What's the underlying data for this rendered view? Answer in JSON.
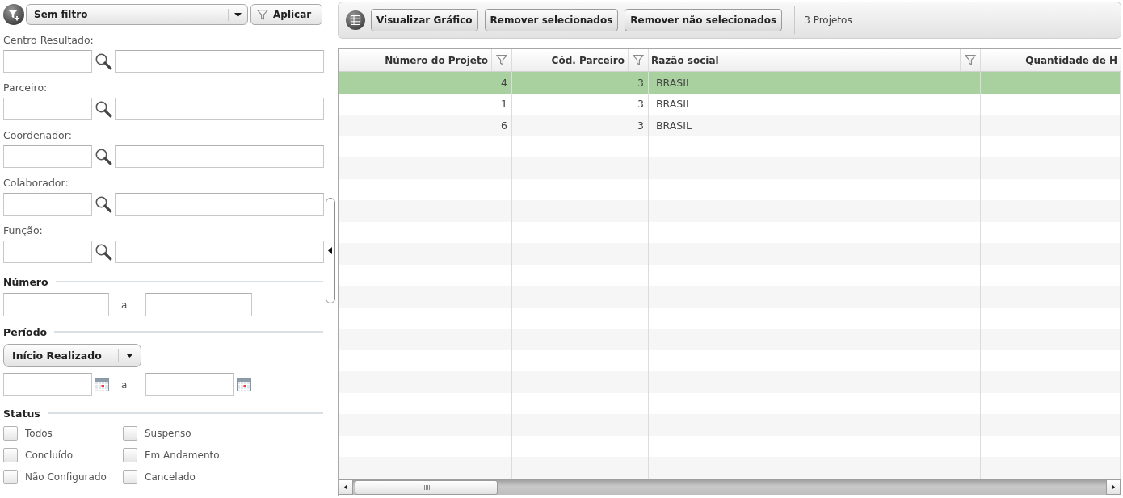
{
  "filter_bar": {
    "preset": "Sem filtro",
    "apply_button": "Aplicar"
  },
  "lookups": [
    {
      "label": "Centro Resultado:"
    },
    {
      "label": "Parceiro:"
    },
    {
      "label": "Coordenador:"
    },
    {
      "label": "Colaborador:"
    },
    {
      "label": "Função:"
    }
  ],
  "number_range": {
    "title": "Número",
    "separator": "a"
  },
  "period": {
    "title": "Período",
    "date_type": "Início Realizado",
    "separator": "a"
  },
  "status": {
    "title": "Status",
    "options": [
      {
        "label": "Todos",
        "checked": false
      },
      {
        "label": "Suspenso",
        "checked": false
      },
      {
        "label": "Concluído",
        "checked": false
      },
      {
        "label": "Em Andamento",
        "checked": false
      },
      {
        "label": "Não Configurado",
        "checked": false
      },
      {
        "label": "Cancelado",
        "checked": false
      }
    ]
  },
  "toolbar": {
    "buttons": [
      "Visualizar Gráfico",
      "Remover selecionados",
      "Remover não selecionados"
    ],
    "count": "3 Projetos"
  },
  "grid": {
    "columns": [
      {
        "label": "Número do Projeto",
        "kind": "number",
        "filter": true
      },
      {
        "label": "Cód. Parceiro",
        "kind": "number",
        "filter": true
      },
      {
        "label": "Razão social",
        "kind": "text",
        "filter": true
      },
      {
        "label": "Quantidade de H",
        "kind": "number",
        "filter": false
      }
    ],
    "rows": [
      {
        "cells": [
          "4",
          "3",
          "BRASIL"
        ],
        "selected": true
      },
      {
        "cells": [
          "1",
          "3",
          "BRASIL"
        ],
        "selected": false
      },
      {
        "cells": [
          "6",
          "3",
          "BRASIL"
        ],
        "selected": false
      }
    ]
  }
}
